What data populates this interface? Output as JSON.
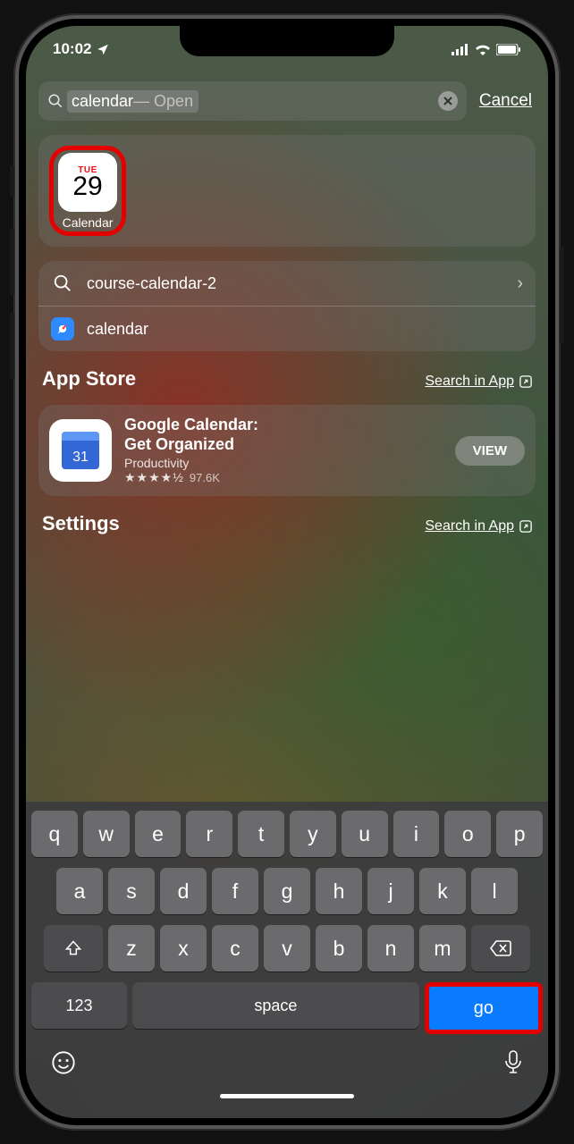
{
  "status": {
    "time": "10:02"
  },
  "search": {
    "typed": "calendar",
    "suggestion_suffix": " — Open",
    "cancel": "Cancel"
  },
  "top_hit": {
    "app_name": "Calendar",
    "day_abbrev": "TUE",
    "day_number": "29"
  },
  "suggestions": [
    {
      "label": "course-calendar-2",
      "icon": "search",
      "chevron": true
    },
    {
      "label": "calendar",
      "icon": "safari",
      "chevron": false
    }
  ],
  "appstore": {
    "heading": "App Store",
    "search_in_app": "Search in App",
    "result": {
      "title1": "Google Calendar:",
      "title2": "Get Organized",
      "category": "Productivity",
      "stars": "★★★★½",
      "ratings_count": "97.6K",
      "icon_number": "31",
      "button": "VIEW"
    }
  },
  "settings": {
    "heading": "Settings",
    "search_in_app": "Search in App"
  },
  "keyboard": {
    "row1": [
      "q",
      "w",
      "e",
      "r",
      "t",
      "y",
      "u",
      "i",
      "o",
      "p"
    ],
    "row2": [
      "a",
      "s",
      "d",
      "f",
      "g",
      "h",
      "j",
      "k",
      "l"
    ],
    "row3": [
      "z",
      "x",
      "c",
      "v",
      "b",
      "n",
      "m"
    ],
    "k123": "123",
    "space": "space",
    "go": "go"
  }
}
